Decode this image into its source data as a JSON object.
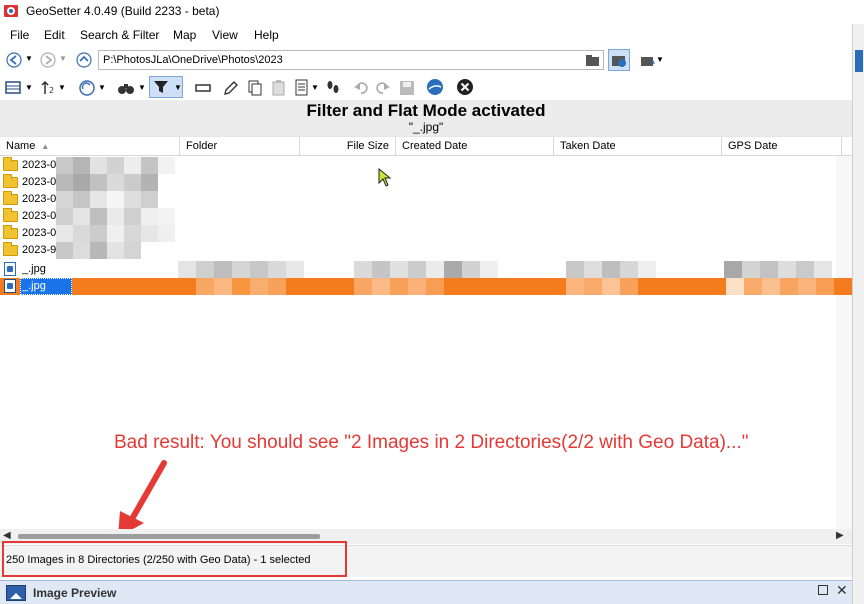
{
  "window": {
    "title": "GeoSetter 4.0.49 (Build 2233 - beta)"
  },
  "menu": {
    "items": [
      "File",
      "Edit",
      "Search & Filter",
      "Map",
      "View",
      "Help"
    ]
  },
  "address": {
    "path": "P:\\PhotosJLa\\OneDrive\\Photos\\2023"
  },
  "banner": {
    "title": "Filter and Flat Mode activated",
    "subtitle": "\"_.jpg\""
  },
  "columns": [
    "Name",
    "Folder",
    "File Size",
    "Created Date",
    "Taken Date",
    "GPS Date"
  ],
  "rows": [
    {
      "type": "folder",
      "name": "2023-0"
    },
    {
      "type": "folder",
      "name": "2023-0"
    },
    {
      "type": "folder",
      "name": "2023-0"
    },
    {
      "type": "folder",
      "name": "2023-0"
    },
    {
      "type": "folder",
      "name": "2023-0"
    },
    {
      "type": "folder",
      "name": "2023-9"
    },
    {
      "type": "image",
      "name": "_.jpg"
    },
    {
      "type": "image",
      "name": "_.jpg",
      "selected": true
    }
  ],
  "annotation": {
    "text": "Bad result: You should see \"2 Images in 2 Directories(2/2 with Geo Data)...\""
  },
  "status": {
    "text": "250 Images in 8 Directories (2/250 with Geo Data) - 1 selected"
  },
  "preview": {
    "title": "Image Preview"
  },
  "colors": {
    "selection": "#f47c1c",
    "annotation": "#e53935",
    "folder": "#f1c232"
  }
}
